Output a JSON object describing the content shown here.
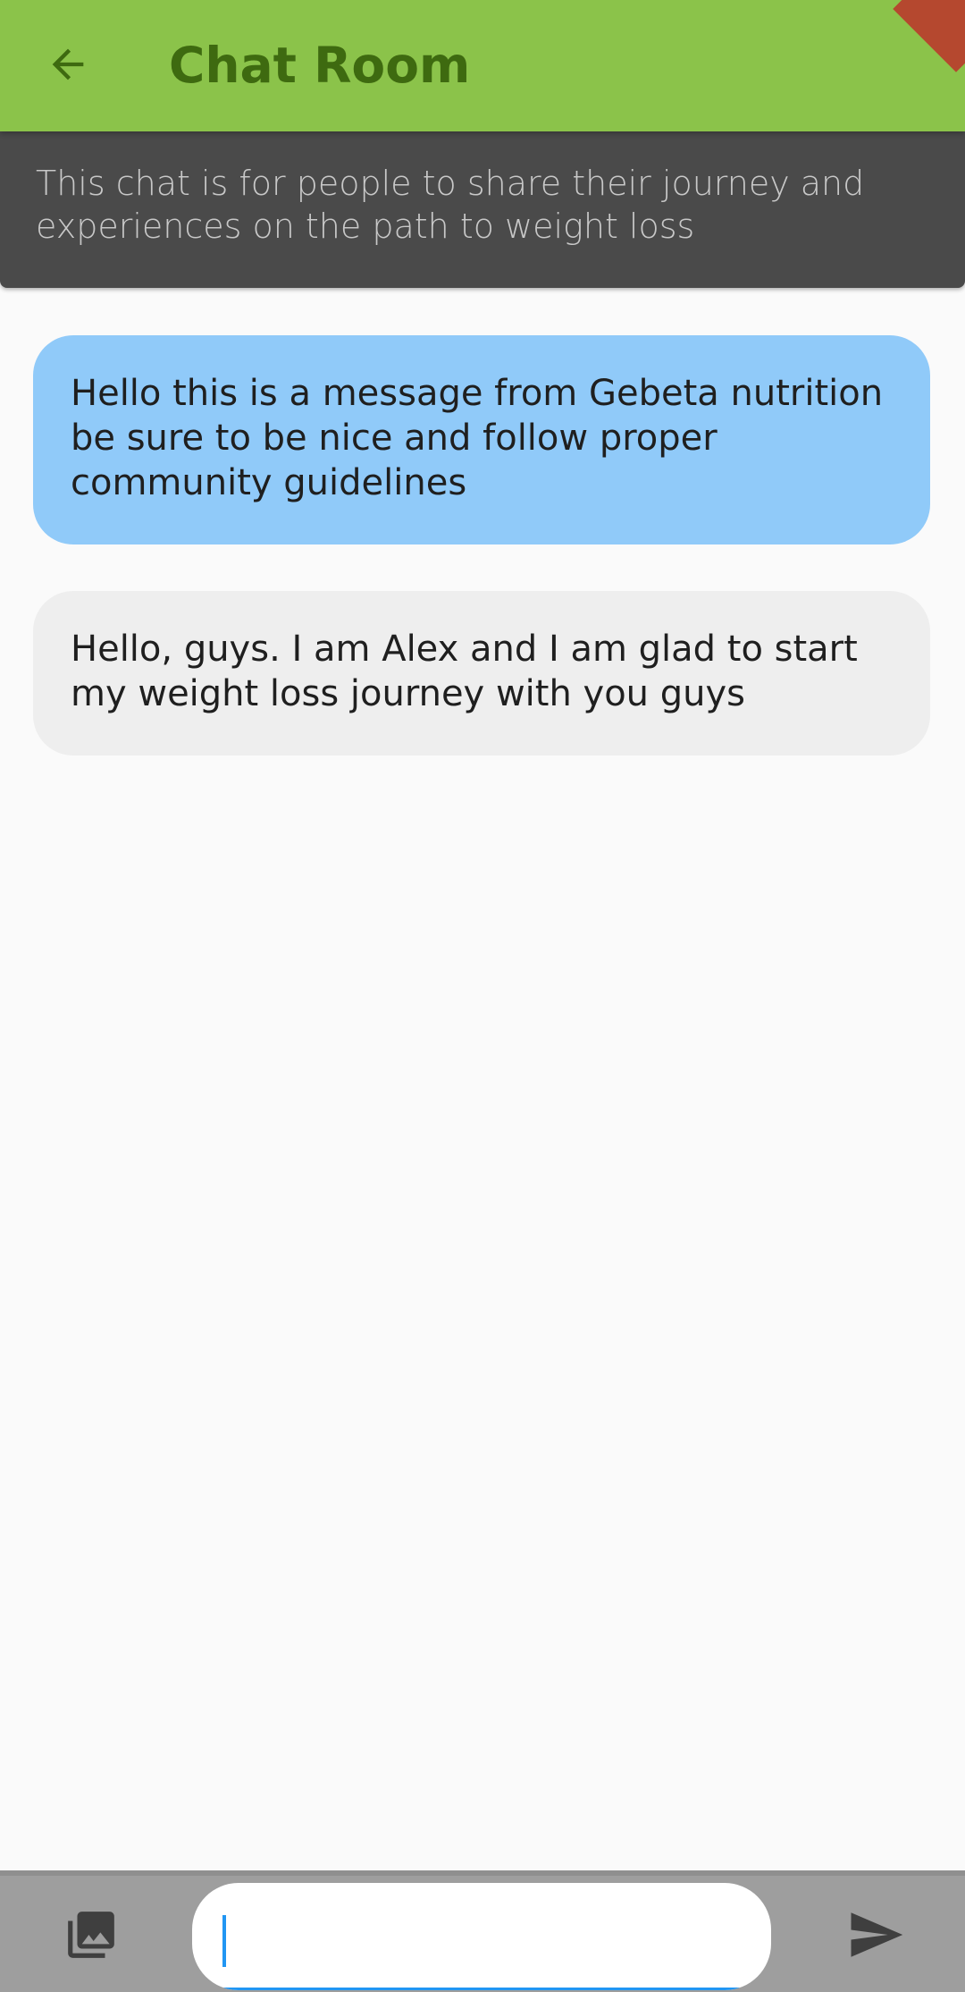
{
  "app_bar": {
    "title": "Chat Room",
    "back_icon": "arrow-back-icon",
    "background_color": "#8bc34a",
    "title_color": "#3e6a10"
  },
  "description": {
    "text": "This chat is for people to share their journey and experiences on the path to weight loss",
    "background_color": "#4a4a4a"
  },
  "messages": [
    {
      "text": " Hello this is a message from Gebeta nutrition be sure to be nice and follow proper community guidelines",
      "bubble_color": "#90caf9"
    },
    {
      "text": " Hello, guys. I am Alex and I am glad to start my weight loss journey with you guys",
      "bubble_color": "#eeeeee"
    }
  ],
  "composer": {
    "image_icon": "photo-library-icon",
    "input_value": "",
    "input_placeholder": "",
    "send_icon": "send-icon",
    "accent_color": "#2196f3"
  }
}
